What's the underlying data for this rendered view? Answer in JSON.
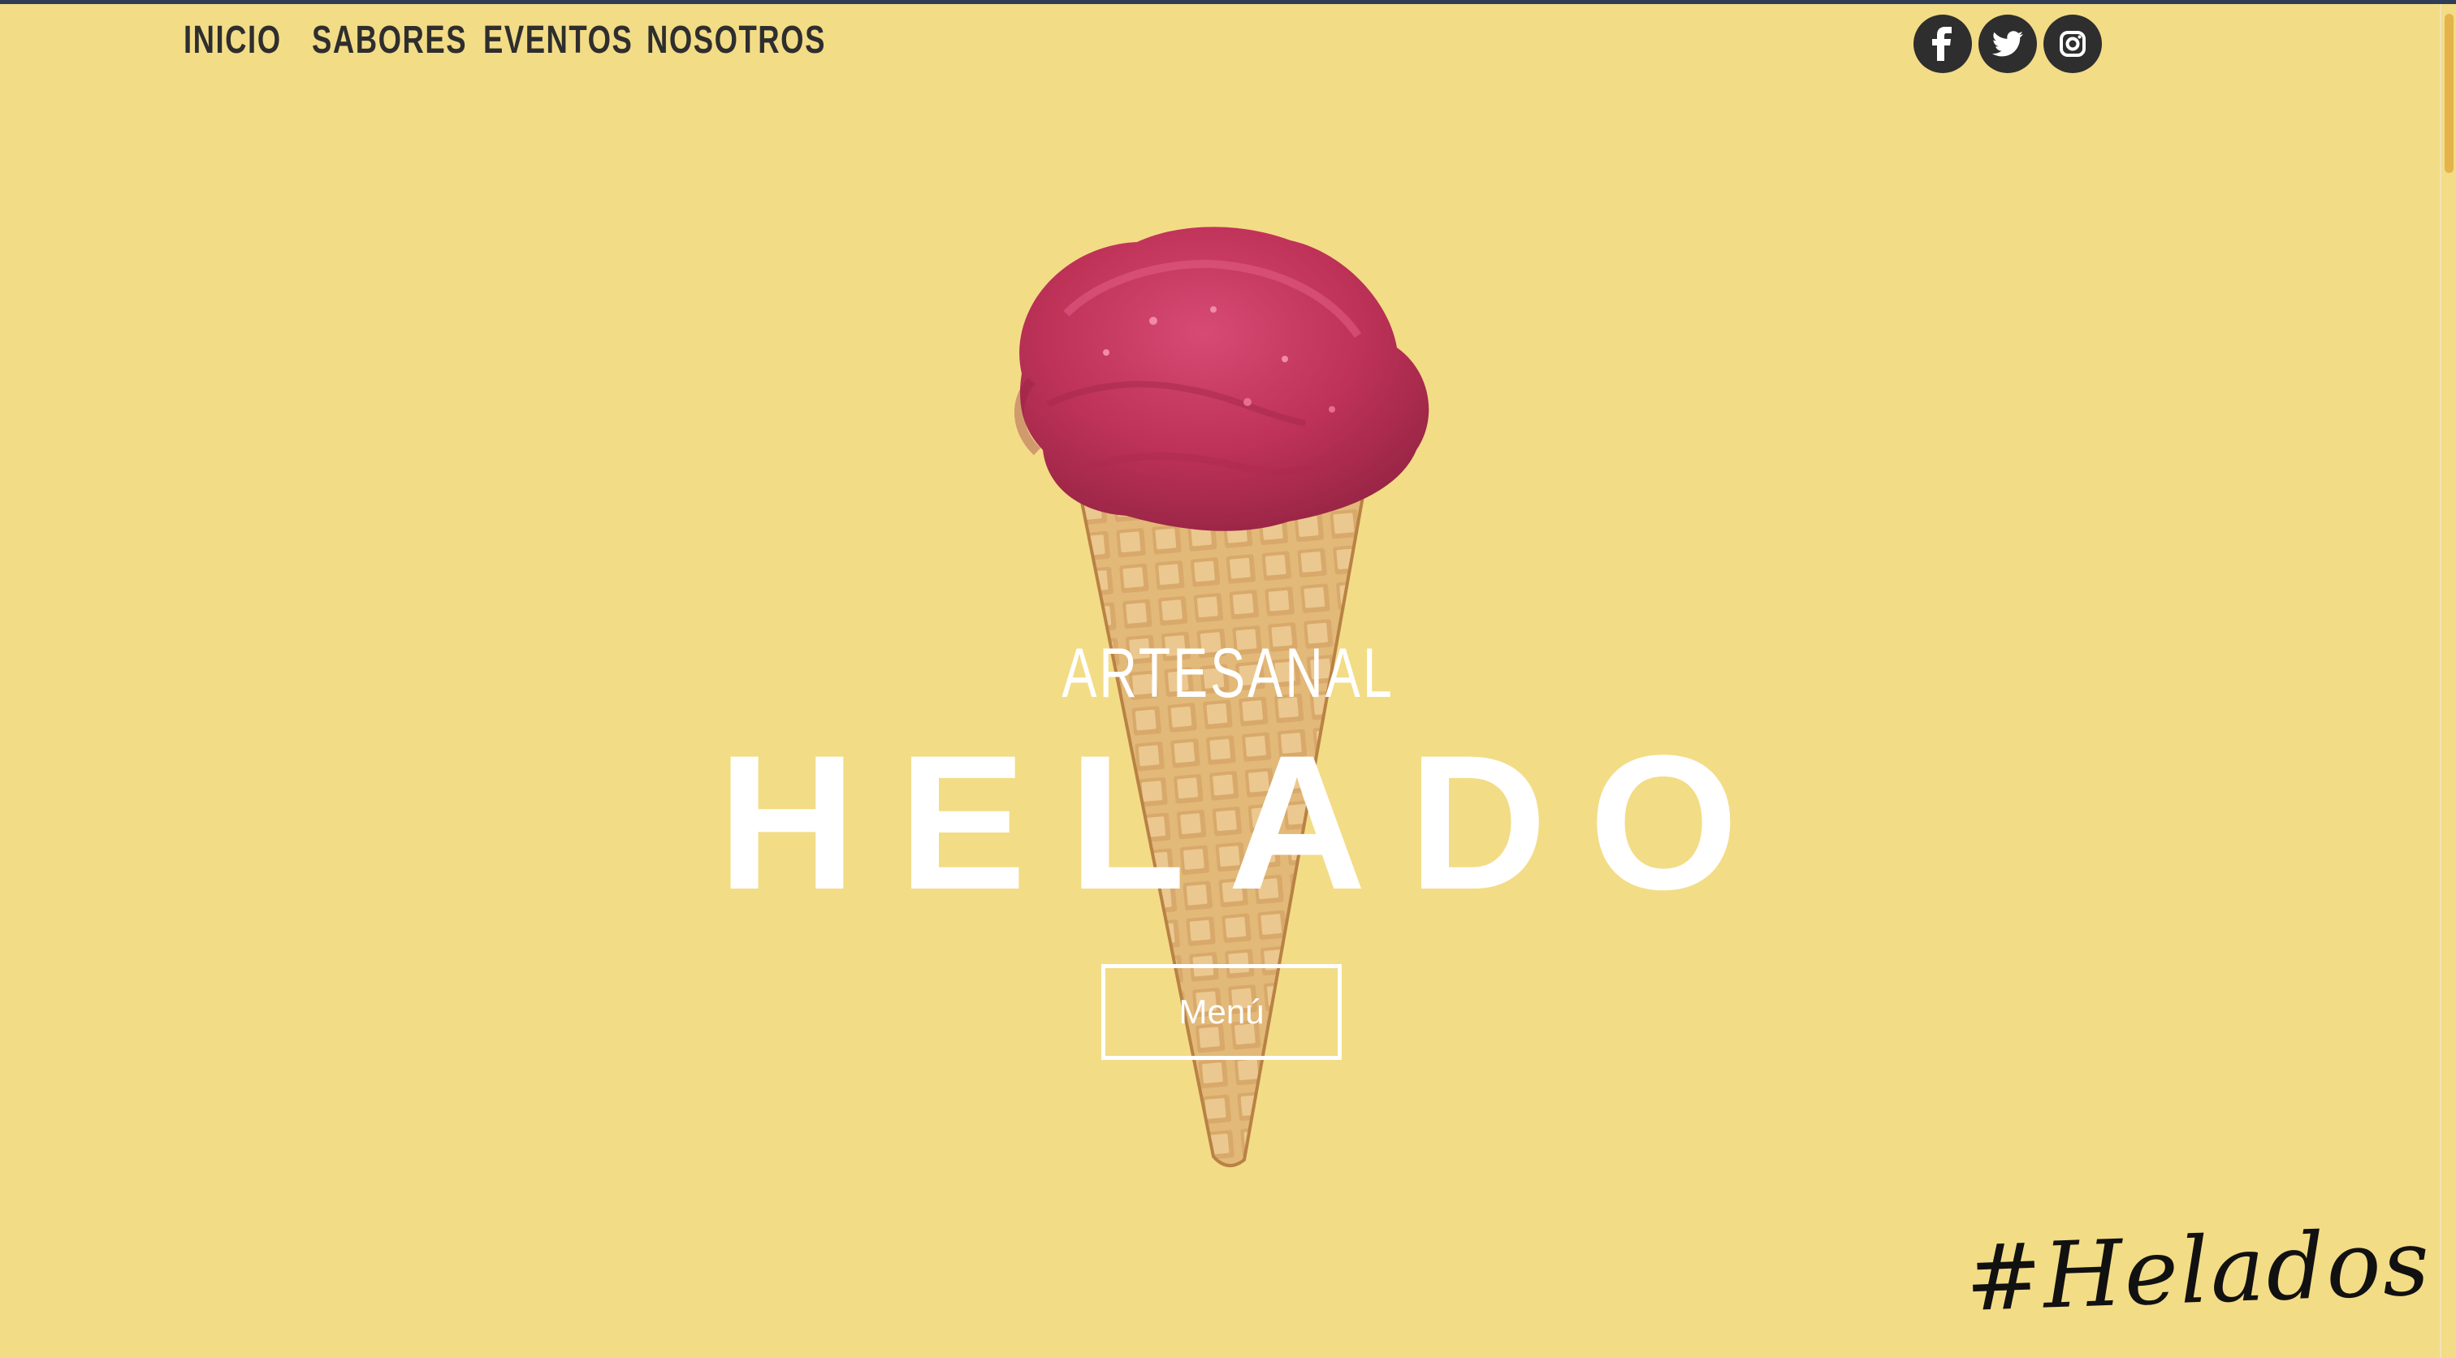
{
  "nav": {
    "items": [
      {
        "label": "INICIO"
      },
      {
        "label": "SABORES"
      },
      {
        "label": "EVENTOS"
      },
      {
        "label": "NOSOTROS"
      }
    ]
  },
  "social": {
    "items": [
      {
        "icon": "facebook-icon"
      },
      {
        "icon": "twitter-icon"
      },
      {
        "icon": "instagram-icon"
      }
    ]
  },
  "hero": {
    "eyebrow": "ARTESANAL",
    "title": "HELADO",
    "button_label": "Menú",
    "image": "ice-cream-cone-image"
  },
  "footer": {
    "hashtag": "#Helados"
  },
  "colors": {
    "background": "#f3dc86",
    "text_dark": "#2e2e2e",
    "white": "#ffffff",
    "ice_cream": "#c63b5f",
    "cone": "#d9aa67"
  }
}
